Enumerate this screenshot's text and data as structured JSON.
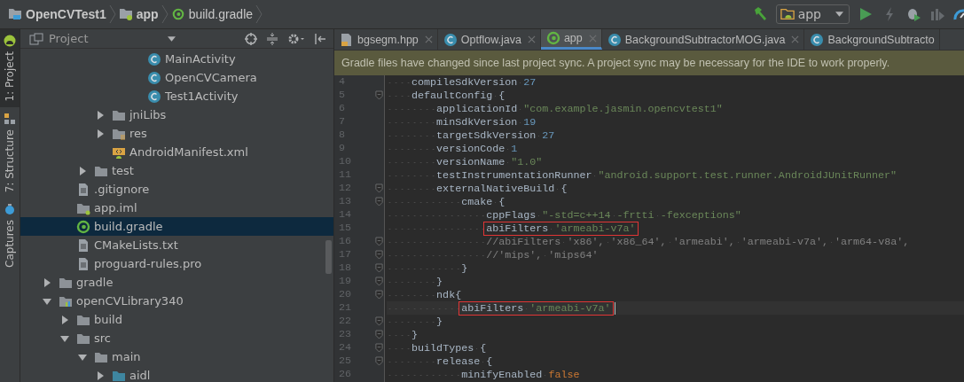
{
  "breadcrumbs": [
    {
      "label": "OpenCVTest1",
      "kind": "project"
    },
    {
      "label": "app",
      "kind": "module"
    },
    {
      "label": "build.gradle",
      "kind": "gradle"
    }
  ],
  "toolbar": [
    {
      "kind": "hammer",
      "disabled": false
    },
    {
      "kind": "run-config",
      "label": "app"
    },
    {
      "kind": "run",
      "disabled": false
    },
    {
      "kind": "apply",
      "disabled": true
    },
    {
      "kind": "debug",
      "disabled": false
    },
    {
      "kind": "attach",
      "disabled": true
    },
    {
      "kind": "profiler",
      "disabled": false
    }
  ],
  "side_tabs": [
    {
      "label": "1: Project",
      "kind": "android",
      "selected": true
    },
    {
      "label": "7: Structure",
      "kind": "structure",
      "selected": false
    },
    {
      "label": "Captures",
      "kind": "captures",
      "selected": false
    }
  ],
  "project_panel": {
    "title": "Project",
    "tree": [
      {
        "children": [
          {
            "children": [
              {
                "children": [
                  {
                    "children": [
                      {
                        "children": [
                          {
                            "label": "MainActivity",
                            "kind": "class",
                            "selected": false
                          },
                          {
                            "label": "OpenCVCamera",
                            "kind": "class",
                            "selected": false
                          },
                          {
                            "label": "Test1Activity",
                            "kind": "class",
                            "selected": false
                          }
                        ]
                      }
                    ]
                  },
                  {
                    "label": "jniLibs",
                    "kind": "folder",
                    "expanded": false,
                    "selected": false
                  },
                  {
                    "label": "res",
                    "kind": "res",
                    "expanded": false,
                    "selected": false
                  },
                  {
                    "label": "AndroidManifest.xml",
                    "kind": "manifest",
                    "selected": false
                  }
                ]
              },
              {
                "label": "test",
                "kind": "folder",
                "expanded": false,
                "selected": false
              }
            ]
          },
          {
            "label": ".gitignore",
            "kind": "file",
            "selected": false
          },
          {
            "label": "app.iml",
            "kind": "iml",
            "selected": false
          },
          {
            "label": "build.gradle",
            "kind": "gradle",
            "selected": true
          },
          {
            "label": "CMakeLists.txt",
            "kind": "file",
            "selected": false
          },
          {
            "label": "proguard-rules.pro",
            "kind": "file",
            "selected": false
          }
        ]
      },
      {
        "label": "gradle",
        "kind": "folder",
        "expanded": false,
        "selected": false
      },
      {
        "label": "openCVLibrary340",
        "kind": "library",
        "expanded": true,
        "selected": false,
        "children": [
          {
            "label": "build",
            "kind": "folder",
            "expanded": false,
            "selected": false
          },
          {
            "label": "src",
            "kind": "folder",
            "expanded": true,
            "selected": false,
            "children": [
              {
                "label": "main",
                "kind": "folder",
                "expanded": true,
                "selected": false,
                "children": [
                  {
                    "label": "aidl",
                    "kind": "source",
                    "expanded": false,
                    "selected": false
                  }
                ]
              }
            ]
          }
        ]
      }
    ]
  },
  "tabs": [
    {
      "label": "bgsegm.hpp",
      "kind": "header",
      "selected": false,
      "closable": true
    },
    {
      "label": "Optflow.java",
      "kind": "class",
      "selected": false,
      "closable": true
    },
    {
      "label": "app",
      "kind": "gradle",
      "selected": true,
      "closable": true
    },
    {
      "label": "BackgroundSubtractorMOG.java",
      "kind": "class",
      "selected": false,
      "closable": true
    },
    {
      "label": "BackgroundSubtracto",
      "kind": "class",
      "selected": false,
      "closable": false
    }
  ],
  "banner": "Gradle files have changed since last project sync. A project sync may be necessary for the IDE to work properly.",
  "code": [
    {
      "number": "4",
      "fold": false,
      "boxed": false,
      "current": false,
      "tokens": [
        {
          "text": "    compileSdkVersion ",
          "kind": "plain"
        },
        {
          "text": "27",
          "kind": "number"
        }
      ]
    },
    {
      "number": "5",
      "fold": true,
      "boxed": false,
      "current": false,
      "tokens": [
        {
          "text": "    defaultConfig {",
          "kind": "plain"
        }
      ]
    },
    {
      "number": "6",
      "fold": false,
      "boxed": false,
      "current": false,
      "tokens": [
        {
          "text": "        applicationId ",
          "kind": "plain"
        },
        {
          "text": "\"com.example.jasmin.opencvtest1\"",
          "kind": "string"
        }
      ]
    },
    {
      "number": "7",
      "fold": false,
      "boxed": false,
      "current": false,
      "tokens": [
        {
          "text": "        minSdkVersion ",
          "kind": "plain"
        },
        {
          "text": "19",
          "kind": "number"
        }
      ]
    },
    {
      "number": "8",
      "fold": false,
      "boxed": false,
      "current": false,
      "tokens": [
        {
          "text": "        targetSdkVersion ",
          "kind": "plain"
        },
        {
          "text": "27",
          "kind": "number"
        }
      ]
    },
    {
      "number": "9",
      "fold": false,
      "boxed": false,
      "current": false,
      "tokens": [
        {
          "text": "        versionCode ",
          "kind": "plain"
        },
        {
          "text": "1",
          "kind": "number"
        }
      ]
    },
    {
      "number": "10",
      "fold": false,
      "boxed": false,
      "current": false,
      "tokens": [
        {
          "text": "        versionName ",
          "kind": "plain"
        },
        {
          "text": "\"1.0\"",
          "kind": "string"
        }
      ]
    },
    {
      "number": "11",
      "fold": false,
      "boxed": false,
      "current": false,
      "tokens": [
        {
          "text": "        testInstrumentationRunner ",
          "kind": "plain"
        },
        {
          "text": "\"android.support.test.runner.AndroidJUnitRunner\"",
          "kind": "string"
        }
      ]
    },
    {
      "number": "12",
      "fold": true,
      "boxed": false,
      "current": false,
      "tokens": [
        {
          "text": "        externalNativeBuild {",
          "kind": "plain"
        }
      ]
    },
    {
      "number": "13",
      "fold": true,
      "boxed": false,
      "current": false,
      "tokens": [
        {
          "text": "            cmake {",
          "kind": "plain"
        }
      ]
    },
    {
      "number": "14",
      "fold": false,
      "boxed": false,
      "current": false,
      "tokens": [
        {
          "text": "                cppFlags ",
          "kind": "plain"
        },
        {
          "text": "\"-std=c++14 -frtti -fexceptions\"",
          "kind": "string"
        }
      ]
    },
    {
      "number": "15",
      "fold": false,
      "boxed": true,
      "current": false,
      "tokens": [
        {
          "text": "                abiFilters ",
          "kind": "plain"
        },
        {
          "text": "'armeabi-v7a'",
          "kind": "string"
        }
      ]
    },
    {
      "number": "16",
      "fold": true,
      "boxed": false,
      "current": false,
      "tokens": [
        {
          "text": "                //abiFilters 'x86', 'x86_64', 'armeabi', 'armeabi-v7a', 'arm64-v8a',",
          "kind": "comment"
        }
      ]
    },
    {
      "number": "17",
      "fold": true,
      "boxed": false,
      "current": false,
      "tokens": [
        {
          "text": "                //'mips', 'mips64'",
          "kind": "comment"
        }
      ]
    },
    {
      "number": "18",
      "fold": true,
      "boxed": false,
      "current": false,
      "tokens": [
        {
          "text": "            }",
          "kind": "plain"
        }
      ]
    },
    {
      "number": "19",
      "fold": true,
      "boxed": false,
      "current": false,
      "tokens": [
        {
          "text": "        }",
          "kind": "plain"
        }
      ]
    },
    {
      "number": "20",
      "fold": true,
      "boxed": false,
      "current": false,
      "tokens": [
        {
          "text": "        ndk{",
          "kind": "plain"
        }
      ]
    },
    {
      "number": "21",
      "fold": false,
      "boxed": true,
      "current": true,
      "tokens": [
        {
          "text": "            abiFilters ",
          "kind": "plain"
        },
        {
          "text": "'armeabi-v7a'",
          "kind": "string"
        }
      ]
    },
    {
      "number": "22",
      "fold": true,
      "boxed": false,
      "current": false,
      "tokens": [
        {
          "text": "        }",
          "kind": "plain"
        }
      ]
    },
    {
      "number": "23",
      "fold": true,
      "boxed": false,
      "current": false,
      "tokens": [
        {
          "text": "    }",
          "kind": "plain"
        }
      ]
    },
    {
      "number": "24",
      "fold": true,
      "boxed": false,
      "current": false,
      "tokens": [
        {
          "text": "    buildTypes {",
          "kind": "plain"
        }
      ]
    },
    {
      "number": "25",
      "fold": true,
      "boxed": false,
      "current": false,
      "tokens": [
        {
          "text": "        release {",
          "kind": "plain"
        }
      ]
    },
    {
      "number": "26",
      "fold": false,
      "boxed": false,
      "current": false,
      "tokens": [
        {
          "text": "            minifyEnabled ",
          "kind": "plain"
        },
        {
          "text": "false",
          "kind": "keyword"
        }
      ]
    }
  ]
}
